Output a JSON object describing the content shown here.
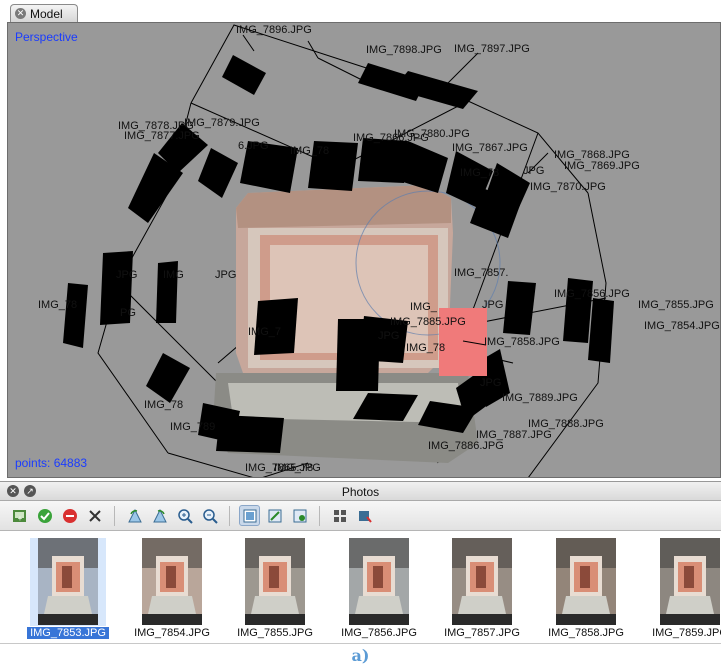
{
  "model": {
    "tab_label": "Model",
    "view_mode": "Perspective",
    "points_label": "points: 64883",
    "camera_labels": [
      "IMG_7896.JPG",
      "IMG_7898.JPG",
      "IMG_7897.JPG",
      "IMG_7878.JPG",
      "IMG_7879.JPG",
      "IMG_7877.JPG",
      "6.JPG",
      "IMG_78",
      "IMG_7866.JPG",
      "IMG_7880.JPG",
      "IMG_7867.JPG",
      "IMG_7868.JPG",
      "IMG_7869.JPG",
      "IMG_78",
      "JPG",
      "IMG_7870.JPG",
      "IMG",
      "JPG",
      "JPG",
      "IMG_7857.",
      "IMG_7856.JPG",
      "IMG_7855.JPG",
      "IMG_78",
      "IMG_7854.JPG",
      "IMG_",
      "JPG",
      "IMG_7885.JPG",
      "IMG_7858.JPG",
      "JPG",
      "IMG_7889.JPG",
      "IMG_7888.JPG",
      "IMG_7887.JPG",
      "IMG_78",
      "IMG_789",
      "IMG_7886.JPG",
      "IMG_7865.JPG",
      "PG",
      "JPG",
      "IMG_7",
      "IMG_78",
      "IMG_78"
    ]
  },
  "photos": {
    "title": "Photos",
    "items": [
      {
        "name": "IMG_7853.JPG",
        "selected": true
      },
      {
        "name": "IMG_7854.JPG",
        "selected": false
      },
      {
        "name": "IMG_7855.JPG",
        "selected": false
      },
      {
        "name": "IMG_7856.JPG",
        "selected": false
      },
      {
        "name": "IMG_7857.JPG",
        "selected": false
      },
      {
        "name": "IMG_7858.JPG",
        "selected": false
      },
      {
        "name": "IMG_7859.JPG",
        "selected": false
      }
    ]
  },
  "caption": "a)",
  "colors": {
    "viewport_bg": "#999999",
    "overlay_text": "#1a3cff",
    "selected_camera": "#f07a7a",
    "selection": "#3875d7",
    "caption": "#5b9bd5"
  },
  "toolbar_icons": [
    "add-photos-icon",
    "enable-icon",
    "disable-icon",
    "remove-icon",
    "rotate-left-icon",
    "rotate-right-icon",
    "zoom-in-icon",
    "zoom-out-icon",
    "thumbnail-view-icon",
    "import-masks-icon",
    "export-masks-icon",
    "detail-view-icon",
    "filter-icon"
  ]
}
